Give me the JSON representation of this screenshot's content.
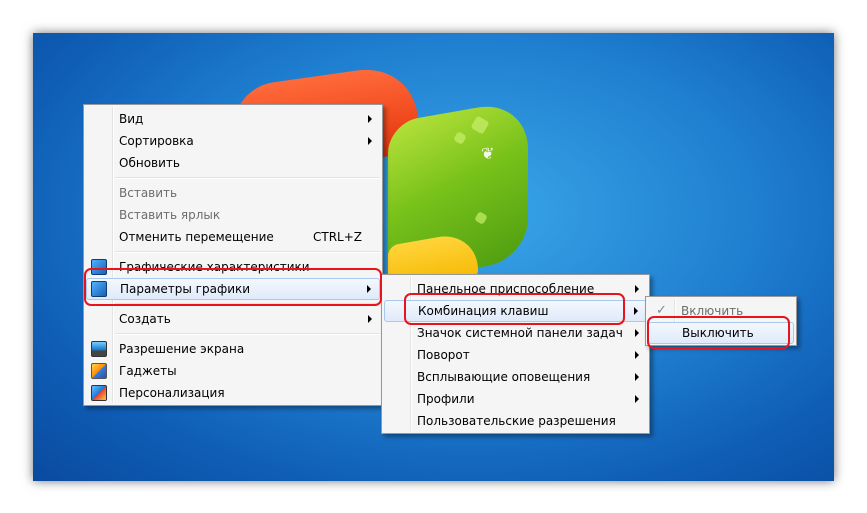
{
  "main_menu": {
    "items": [
      {
        "label": "Вид",
        "submenu": true
      },
      {
        "label": "Сортировка",
        "submenu": true
      },
      {
        "label": "Обновить"
      },
      {
        "label": "Вставить",
        "disabled": true
      },
      {
        "label": "Вставить ярлык",
        "disabled": true
      },
      {
        "label": "Отменить перемещение",
        "shortcut": "CTRL+Z"
      },
      {
        "label": "Графические характеристики",
        "icon": "graphics-icon"
      },
      {
        "label": "Параметры графики",
        "icon": "graphics-icon",
        "submenu": true,
        "highlighted": true
      },
      {
        "label": "Создать",
        "submenu": true
      },
      {
        "label": "Разрешение экрана",
        "icon": "screen-resolution-icon"
      },
      {
        "label": "Гаджеты",
        "icon": "gadgets-icon"
      },
      {
        "label": "Персонализация",
        "icon": "personalization-icon"
      }
    ]
  },
  "graphics_submenu": {
    "items": [
      {
        "label": "Панельное приспособление",
        "submenu": true
      },
      {
        "label": "Комбинация клавиш",
        "submenu": true,
        "highlighted": true
      },
      {
        "label": "Значок системной панели задач",
        "submenu": true
      },
      {
        "label": "Поворот",
        "submenu": true
      },
      {
        "label": "Всплывающие оповещения",
        "submenu": true
      },
      {
        "label": "Профили",
        "submenu": true
      },
      {
        "label": "Пользовательские разрешения"
      }
    ]
  },
  "hotkey_submenu": {
    "items": [
      {
        "label": "Включить",
        "disabled": true,
        "checked": true,
        "check_glyph": "✓"
      },
      {
        "label": "Выключить",
        "highlighted": true
      }
    ]
  },
  "colors": {
    "annotation_ring": "#e8141c",
    "menu_background": "#f5f5f5",
    "hover_border": "#a8c8ef"
  }
}
